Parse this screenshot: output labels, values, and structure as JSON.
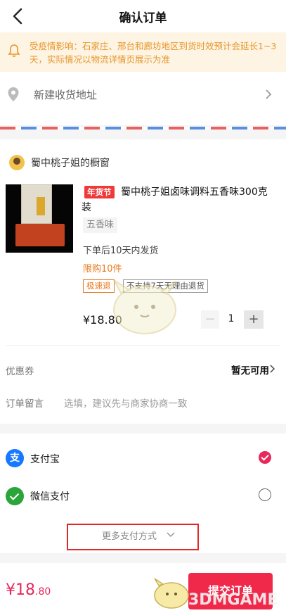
{
  "header": {
    "title": "确认订单"
  },
  "notice": {
    "text": "受疫情影响：石家庄、邢台和廊坊地区到货时效预计会延长1~3天，实际情况以物流详情页展示为准"
  },
  "address": {
    "label": "新建收货地址"
  },
  "shop": {
    "name": "蜀中桃子姐的橱窗",
    "product": {
      "badge": "年货节",
      "name": "蜀中桃子姐卤味调料五香味300克装",
      "variant": "五香味",
      "shipping": "下单后10天内发货",
      "limit": "限购10件",
      "tags": [
        "极速退",
        "不支持7天无理由退货"
      ],
      "price": "¥18.80",
      "quantity": "1",
      "minus": "−",
      "plus": "+"
    },
    "coupon": {
      "label": "优惠券",
      "value": "暂无可用"
    },
    "message": {
      "label": "订单留言",
      "placeholder": "选填，建议先与商家协商一致"
    }
  },
  "payment": {
    "alipay": {
      "label": "支付宝",
      "icon": "支"
    },
    "wechat": {
      "label": "微信支付"
    },
    "more": "更多支付方式"
  },
  "bottom": {
    "total_main": "¥18",
    "total_fraction": ".80",
    "submit": "提交订单"
  },
  "watermark": "3DMGAME",
  "colors": {
    "accent": "#f0294a",
    "notice": "#e8962b",
    "alipay": "#1677ff",
    "wechat": "#2ba53a"
  }
}
